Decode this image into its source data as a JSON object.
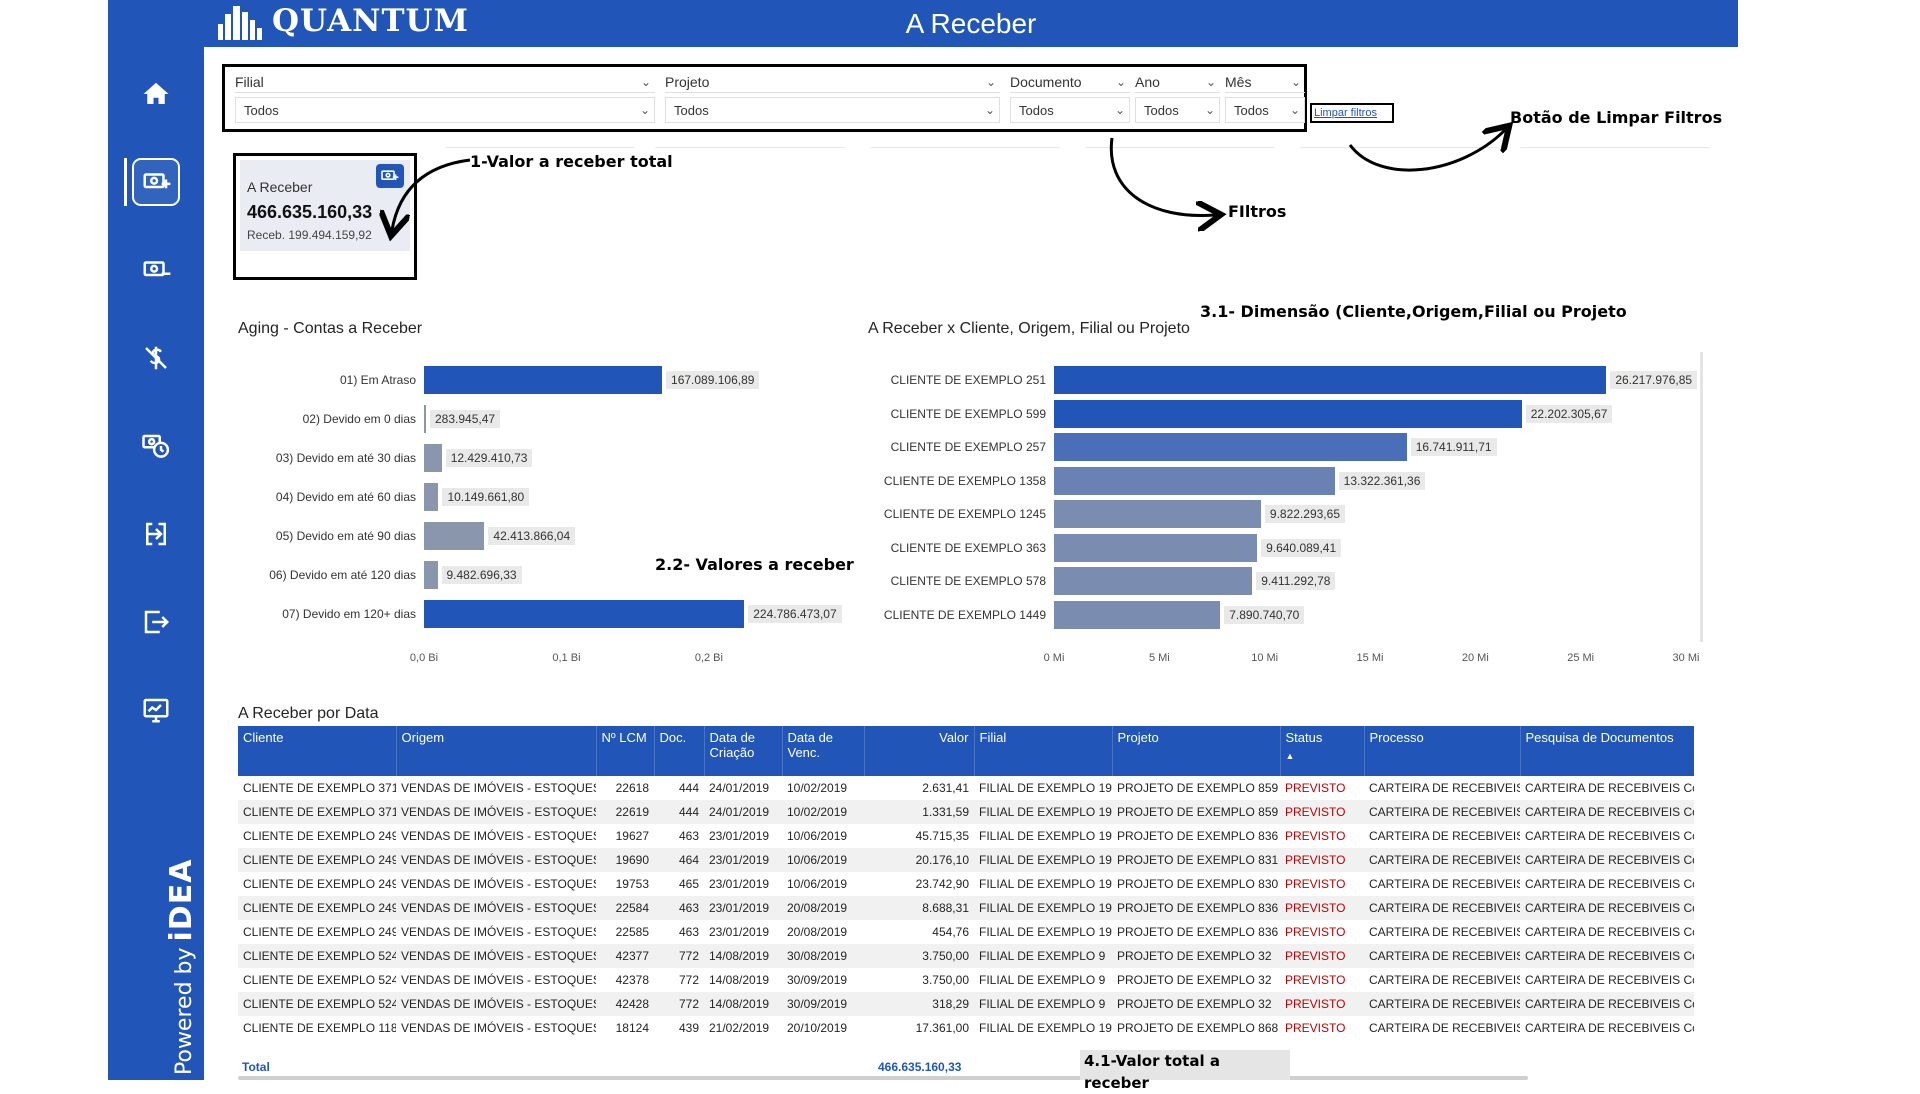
{
  "app": {
    "logo_text": "QUANTUM",
    "page_title": "A Receber",
    "powered_by": "Powered by",
    "powered_brand": "iDEA"
  },
  "colors": {
    "brand_blue": "#2156b8",
    "bar_grey": "#8a96ab",
    "bar_blue": "#2156b8",
    "status_red": "#c00000"
  },
  "nav": [
    {
      "icon": "home-icon"
    },
    {
      "icon": "money-receive-icon",
      "active": true
    },
    {
      "icon": "money-pay-icon"
    },
    {
      "icon": "cancel-dollar-icon"
    },
    {
      "icon": "money-clock-icon"
    },
    {
      "icon": "login-icon"
    },
    {
      "icon": "logout-icon"
    },
    {
      "icon": "dashboard-monitor-icon"
    }
  ],
  "filters": [
    {
      "label": "Filial",
      "value": "Todos"
    },
    {
      "label": "Projeto",
      "value": "Todos"
    },
    {
      "label": "Documento",
      "value": "Todos"
    },
    {
      "label": "Ano",
      "value": "Todos"
    },
    {
      "label": "Mês",
      "value": "Todos"
    }
  ],
  "clear_filters_label": "Limpar filtros",
  "kpi": {
    "label": "A Receber",
    "value": "466.635.160,33",
    "sub": "Receb. 199.494.159,92"
  },
  "annotations": {
    "kpi": "1-Valor a receber total",
    "clear": "Botão de Limpar Filtros",
    "filters": "FIltros",
    "dimension": "3.1- Dimensão (Cliente,Origem,Filial ou Projeto",
    "values": "2.2- Valores a receber",
    "total": "4.1-Valor total a receber"
  },
  "aging_title": "Aging - Contas a Receber",
  "client_title": "A Receber x Cliente, Origem, Filial ou Projeto",
  "chart_data": [
    {
      "type": "bar",
      "orientation": "horizontal",
      "title": "Aging - Contas a Receber",
      "categories": [
        "01) Em Atraso",
        "02) Devido em 0 dias",
        "03) Devido em até 30 dias",
        "04) Devido em até 60 dias",
        "05) Devido em até 90 dias",
        "06) Devido em até 120 dias",
        "07) Devido em 120+ dias"
      ],
      "values": [
        167089106.89,
        283945.47,
        12429410.73,
        10149661.8,
        42413866.04,
        9482696.33,
        224786473.07
      ],
      "value_labels": [
        "167.089.106,89",
        "283.945,47",
        "12.429.410,73",
        "10.149.661,80",
        "42.413.866,04",
        "9.482.696,33",
        "224.786.473,07"
      ],
      "bar_colors": [
        "#2156b8",
        "#8a96ab",
        "#8a96ab",
        "#8a96ab",
        "#8a96ab",
        "#8a96ab",
        "#2156b8"
      ],
      "xlim": [
        0,
        285000000
      ],
      "xticks": [
        0,
        100000000,
        200000000
      ],
      "xtick_labels": [
        "0,0 Bi",
        "0,1 Bi",
        "0,2 Bi"
      ]
    },
    {
      "type": "bar",
      "orientation": "horizontal",
      "title": "A Receber x Cliente, Origem, Filial ou Projeto",
      "categories": [
        "CLIENTE DE EXEMPLO 251",
        "CLIENTE DE EXEMPLO 599",
        "CLIENTE DE EXEMPLO 257",
        "CLIENTE DE EXEMPLO 1358",
        "CLIENTE DE EXEMPLO 1245",
        "CLIENTE DE EXEMPLO 363",
        "CLIENTE DE EXEMPLO 578",
        "CLIENTE DE EXEMPLO 1449"
      ],
      "values": [
        26217976.85,
        22202305.67,
        16741911.71,
        13322361.36,
        9822293.65,
        9640089.41,
        9411292.78,
        7890740.7
      ],
      "value_labels": [
        "26.217.976,85",
        "22.202.305,67",
        "16.741.911,71",
        "13.322.361,36",
        "9.822.293,65",
        "9.640.089,41",
        "9.411.292,78",
        "7.890.740,70"
      ],
      "bar_colors": [
        "#2156b8",
        "#2156b8",
        "#4a6fb8",
        "#6a82b3",
        "#7a8cb0",
        "#7a8cb0",
        "#7a8cb0",
        "#7a8cb0"
      ],
      "xlim": [
        0,
        30000000
      ],
      "xticks": [
        0,
        5000000,
        10000000,
        15000000,
        20000000,
        25000000,
        30000000
      ],
      "xtick_labels": [
        "0 Mi",
        "5 Mi",
        "10 Mi",
        "15 Mi",
        "20 Mi",
        "25 Mi",
        "30 Mi"
      ]
    }
  ],
  "table": {
    "title": "A Receber por Data",
    "columns": [
      "Cliente",
      "Origem",
      "Nº LCM",
      "Doc.",
      "Data de Criação",
      "Data de Venc.",
      "Valor",
      "Filial",
      "Projeto",
      "Status",
      "Processo",
      "Pesquisa de Documentos"
    ],
    "rows": [
      [
        "CLIENTE DE EXEMPLO 371",
        "VENDAS DE IMÓVEIS - ESTOQUES",
        "22618",
        "444",
        "24/01/2019",
        "10/02/2019",
        "2.631,41",
        "FILIAL DE EXEMPLO 19",
        "PROJETO DE EXEMPLO 859",
        "PREVISTO",
        "CARTEIRA DE RECEBIVEIS",
        "CARTEIRA DE RECEBIVEIS Co"
      ],
      [
        "CLIENTE DE EXEMPLO 371",
        "VENDAS DE IMÓVEIS - ESTOQUES",
        "22619",
        "444",
        "24/01/2019",
        "10/02/2019",
        "1.331,59",
        "FILIAL DE EXEMPLO 19",
        "PROJETO DE EXEMPLO 859",
        "PREVISTO",
        "CARTEIRA DE RECEBIVEIS",
        "CARTEIRA DE RECEBIVEIS Co"
      ],
      [
        "CLIENTE DE EXEMPLO 249",
        "VENDAS DE IMÓVEIS - ESTOQUES",
        "19627",
        "463",
        "23/01/2019",
        "10/06/2019",
        "45.715,35",
        "FILIAL DE EXEMPLO 19",
        "PROJETO DE EXEMPLO 836",
        "PREVISTO",
        "CARTEIRA DE RECEBIVEIS",
        "CARTEIRA DE RECEBIVEIS Co"
      ],
      [
        "CLIENTE DE EXEMPLO 249",
        "VENDAS DE IMÓVEIS - ESTOQUES",
        "19690",
        "464",
        "23/01/2019",
        "10/06/2019",
        "20.176,10",
        "FILIAL DE EXEMPLO 19",
        "PROJETO DE EXEMPLO 831",
        "PREVISTO",
        "CARTEIRA DE RECEBIVEIS",
        "CARTEIRA DE RECEBIVEIS Co"
      ],
      [
        "CLIENTE DE EXEMPLO 249",
        "VENDAS DE IMÓVEIS - ESTOQUES",
        "19753",
        "465",
        "23/01/2019",
        "10/06/2019",
        "23.742,90",
        "FILIAL DE EXEMPLO 19",
        "PROJETO DE EXEMPLO 830",
        "PREVISTO",
        "CARTEIRA DE RECEBIVEIS",
        "CARTEIRA DE RECEBIVEIS Co"
      ],
      [
        "CLIENTE DE EXEMPLO 249",
        "VENDAS DE IMÓVEIS - ESTOQUES",
        "22584",
        "463",
        "23/01/2019",
        "20/08/2019",
        "8.688,31",
        "FILIAL DE EXEMPLO 19",
        "PROJETO DE EXEMPLO 836",
        "PREVISTO",
        "CARTEIRA DE RECEBIVEIS",
        "CARTEIRA DE RECEBIVEIS Co"
      ],
      [
        "CLIENTE DE EXEMPLO 249",
        "VENDAS DE IMÓVEIS - ESTOQUES",
        "22585",
        "463",
        "23/01/2019",
        "20/08/2019",
        "454,76",
        "FILIAL DE EXEMPLO 19",
        "PROJETO DE EXEMPLO 836",
        "PREVISTO",
        "CARTEIRA DE RECEBIVEIS",
        "CARTEIRA DE RECEBIVEIS Co"
      ],
      [
        "CLIENTE DE EXEMPLO 524",
        "VENDAS DE IMÓVEIS - ESTOQUES",
        "42377",
        "772",
        "14/08/2019",
        "30/08/2019",
        "3.750,00",
        "FILIAL DE EXEMPLO 9",
        "PROJETO DE EXEMPLO 32",
        "PREVISTO",
        "CARTEIRA DE RECEBIVEIS",
        "CARTEIRA DE RECEBIVEIS Co"
      ],
      [
        "CLIENTE DE EXEMPLO 524",
        "VENDAS DE IMÓVEIS - ESTOQUES",
        "42378",
        "772",
        "14/08/2019",
        "30/09/2019",
        "3.750,00",
        "FILIAL DE EXEMPLO 9",
        "PROJETO DE EXEMPLO 32",
        "PREVISTO",
        "CARTEIRA DE RECEBIVEIS",
        "CARTEIRA DE RECEBIVEIS Co"
      ],
      [
        "CLIENTE DE EXEMPLO 524",
        "VENDAS DE IMÓVEIS - ESTOQUES",
        "42428",
        "772",
        "14/08/2019",
        "30/09/2019",
        "318,29",
        "FILIAL DE EXEMPLO 9",
        "PROJETO DE EXEMPLO 32",
        "PREVISTO",
        "CARTEIRA DE RECEBIVEIS",
        "CARTEIRA DE RECEBIVEIS Co"
      ],
      [
        "CLIENTE DE EXEMPLO 118",
        "VENDAS DE IMÓVEIS - ESTOQUES",
        "18124",
        "439",
        "21/02/2019",
        "20/10/2019",
        "17.361,00",
        "FILIAL DE EXEMPLO 19",
        "PROJETO DE EXEMPLO 868",
        "PREVISTO",
        "CARTEIRA DE RECEBIVEIS",
        "CARTEIRA DE RECEBIVEIS Co"
      ]
    ],
    "total_label": "Total",
    "total_value": "466.635.160,33",
    "sort_indicator": "▲"
  }
}
